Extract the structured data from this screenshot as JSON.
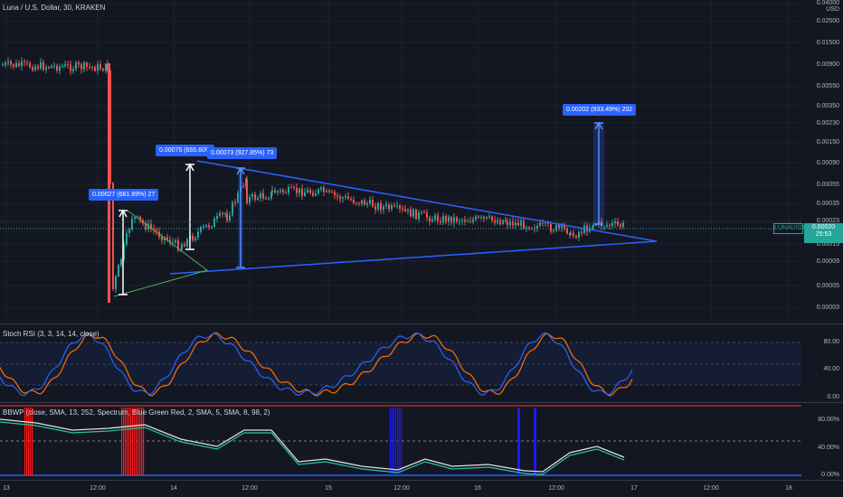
{
  "header": {
    "title": "Luna / U.S. Dollar, 30, KRAKEN"
  },
  "price_axis": {
    "unit": "USD",
    "ticks": [
      "0.04000",
      "0.02500",
      "0.01500",
      "0.00900",
      "0.00550",
      "0.00350",
      "0.00230",
      "0.00150",
      "0.00090",
      "0.00055",
      "0.00035",
      "0.00023",
      "0.00015",
      "0.00009",
      "0.00005",
      "0.00003"
    ]
  },
  "symbol_tag": {
    "symbol": "LUNAUSD",
    "price": "0.00020",
    "countdown": "25:53"
  },
  "measurements": [
    {
      "text": "0.00027 (681.89%) 27"
    },
    {
      "text": "0.00075 (655.60%"
    },
    {
      "text": "0.00073 (927.85%) 73"
    },
    {
      "text": "0.00202 (933.49%) 202"
    }
  ],
  "rsi": {
    "title": "Stoch RSI (3, 3, 14, 14, close)",
    "ticks": [
      "80.00",
      "40.00",
      "0.00"
    ]
  },
  "bbwp": {
    "title": "BBWP (close, SMA, 13, 252, Spectrum, Blue Green Red, 2, SMA, 5, SMA, 8, 98, 2)",
    "ticks": [
      "80.00%",
      "40.00%",
      "0.00%"
    ]
  },
  "time_axis": [
    "13",
    "12:00",
    "14",
    "12:00",
    "15",
    "12:00",
    "16",
    "12:00",
    "17",
    "12:00",
    "18"
  ],
  "colors": {
    "up": "#26a69a",
    "down": "#ef5350",
    "accent": "#2962ff",
    "background": "#131722"
  }
}
